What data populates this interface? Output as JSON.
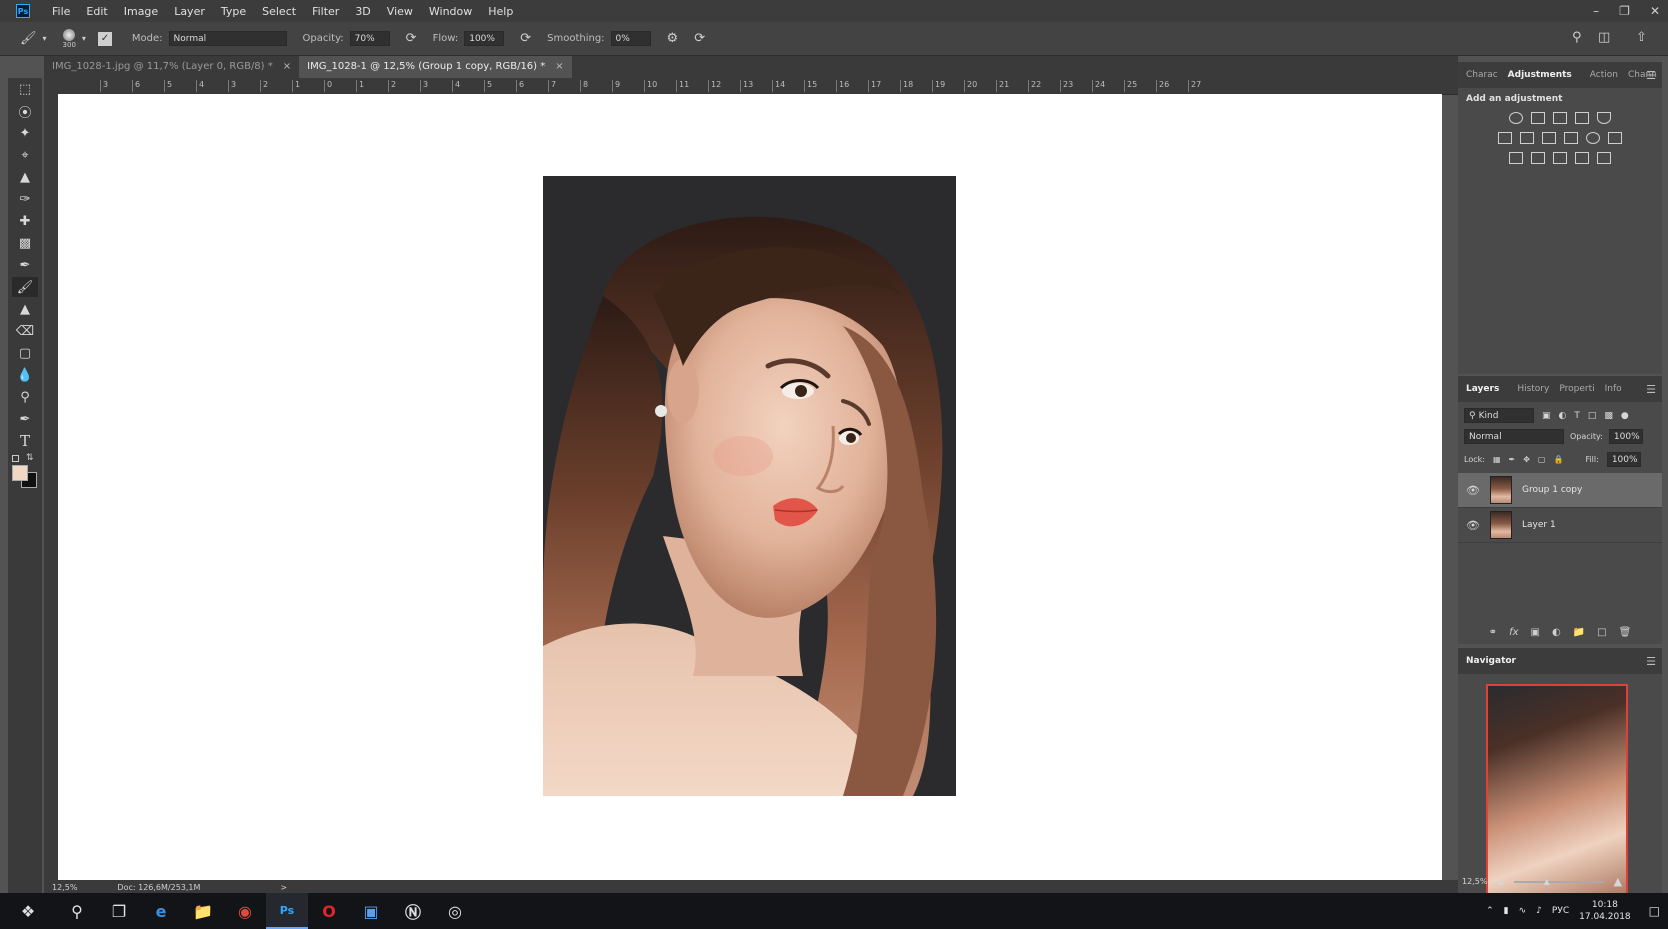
{
  "menu": {
    "app_icon": "Ps",
    "items": [
      "File",
      "Edit",
      "Image",
      "Layer",
      "Type",
      "Select",
      "Filter",
      "3D",
      "View",
      "Window",
      "Help"
    ]
  },
  "options_bar": {
    "brush_size": "300",
    "mode_label": "Mode:",
    "mode_value": "Normal",
    "opacity_label": "Opacity:",
    "opacity_value": "70%",
    "flow_label": "Flow:",
    "flow_value": "100%",
    "smoothing_label": "Smoothing:",
    "smoothing_value": "0%"
  },
  "tabs": [
    {
      "label": "IMG_1028-1.jpg @ 11,7% (Layer 0, RGB/8) *",
      "close": "×",
      "active": false
    },
    {
      "label": "IMG_1028-1 @ 12,5% (Group 1 copy, RGB/16) *",
      "close": "×",
      "active": true
    }
  ],
  "ruler_h_ticks": [
    "3",
    "6",
    "5",
    "4",
    "3",
    "2",
    "1",
    "0",
    "1",
    "2",
    "3",
    "4",
    "5",
    "6",
    "7",
    "8",
    "9",
    "10",
    "11",
    "12",
    "13",
    "14",
    "15",
    "16",
    "17",
    "18",
    "19",
    "20",
    "21",
    "22",
    "23",
    "24",
    "25",
    "26",
    "27"
  ],
  "status": {
    "zoom": "12,5%",
    "doc": "Doc: 126,6M/253,1M",
    "arrow": ">"
  },
  "adjustments_panel": {
    "tabs": [
      "Charac",
      "Adjustments",
      "Action",
      "Chann"
    ],
    "active_tab": "Adjustments",
    "heading": "Add an adjustment"
  },
  "layers_panel": {
    "tabs": [
      "Layers",
      "History",
      "Properti",
      "Info"
    ],
    "active_tab": "Layers",
    "filter_kind": "Kind",
    "blend_mode": "Normal",
    "opacity_label": "Opacity:",
    "opacity_value": "100%",
    "lock_label": "Lock:",
    "fill_label": "Fill:",
    "fill_value": "100%",
    "layers": [
      {
        "name": "Group 1 copy",
        "selected": true
      },
      {
        "name": "Layer 1",
        "selected": false
      }
    ]
  },
  "navigator_panel": {
    "title": "Navigator",
    "zoom": "12,5%"
  },
  "taskbar": {
    "language": "РУС",
    "time": "10:18",
    "date": "17.04.2018"
  },
  "colors": {
    "accent": "#31a8ff",
    "navigator_frame": "#e0403a",
    "foreground_swatch": "#f0d9c4",
    "background_swatch": "#111111"
  }
}
